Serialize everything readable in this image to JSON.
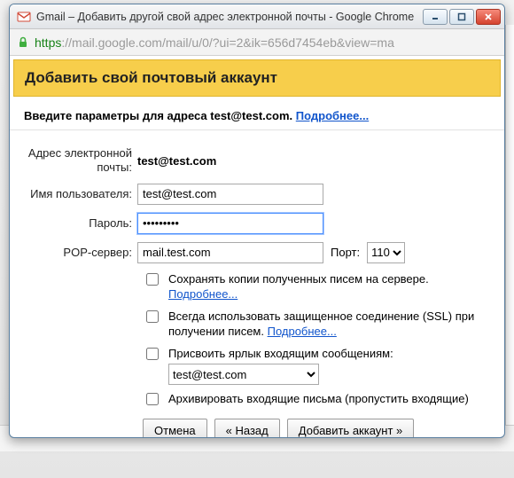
{
  "window": {
    "title": "Gmail – Добавить другой свой адрес электронной почты - Google Chrome"
  },
  "address": {
    "scheme": "https",
    "host": "://mail.google.com",
    "path": "/mail/u/0/?ui=2&ik=656d7454eb&view=ma"
  },
  "header": "Добавить свой почтовый аккаунт",
  "subheader": {
    "prefix": "Введите параметры для адреса ",
    "email": "test@test.com",
    "period": ". ",
    "more": "Подробнее..."
  },
  "form": {
    "email_label": "Адрес электронной почты:",
    "email_value": "test@test.com",
    "username_label": "Имя пользователя:",
    "username_value": "test@test.com",
    "password_label": "Пароль:",
    "password_value": "•••••••••",
    "pop_label": "POP-сервер:",
    "pop_value": "mail.test.com",
    "port_label": "Порт:",
    "port_value": "110"
  },
  "options": {
    "keep_copy": "Сохранять копии полученных писем на сервере. ",
    "keep_copy_more": "Подробнее...",
    "ssl": "Всегда использовать защищенное соединение (SSL) при получении писем. ",
    "ssl_more": "Подробнее...",
    "label_incoming": "Присвоить ярлык входящим сообщениям:",
    "label_value": "test@test.com",
    "archive": "Архивировать входящие письма (пропустить входящие)"
  },
  "buttons": {
    "cancel": "Отмена",
    "back": "« Назад",
    "add": "Добавить аккаунт »"
  }
}
